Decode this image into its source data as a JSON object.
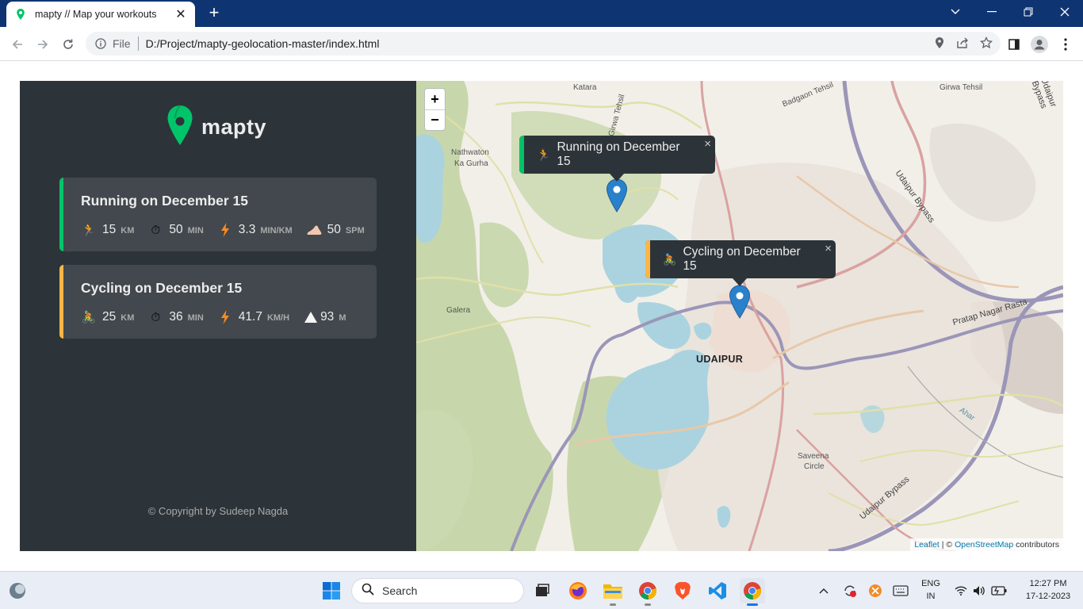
{
  "browser": {
    "tab_title": "mapty // Map your workouts",
    "omnibox_scheme": "File",
    "url": "D:/Project/mapty-geolocation-master/index.html"
  },
  "app": {
    "logo_text": "mapty",
    "brand_green": "#00c46a",
    "cycling_yellow": "#ffb545",
    "workouts": [
      {
        "type": "running",
        "title": "Running on December 15",
        "stats": [
          {
            "icon": "runner-icon",
            "value": "15",
            "unit": "KM"
          },
          {
            "icon": "stopwatch-icon",
            "value": "50",
            "unit": "MIN"
          },
          {
            "icon": "lightning-icon",
            "value": "3.3",
            "unit": "MIN/KM"
          },
          {
            "icon": "foot-icon",
            "value": "50",
            "unit": "SPM"
          }
        ]
      },
      {
        "type": "cycling",
        "title": "Cycling on December 15",
        "stats": [
          {
            "icon": "cyclist-icon",
            "value": "25",
            "unit": "KM"
          },
          {
            "icon": "stopwatch-icon",
            "value": "36",
            "unit": "MIN"
          },
          {
            "icon": "lightning-icon",
            "value": "41.7",
            "unit": "KM/H"
          },
          {
            "icon": "mountain-icon",
            "value": "93",
            "unit": "M"
          }
        ]
      }
    ],
    "copyright": "© Copyright by Sudeep Nagda"
  },
  "map": {
    "zoom_in": "+",
    "zoom_out": "−",
    "popups": [
      {
        "text": "Running on December 15",
        "close": "×"
      },
      {
        "text": "Cycling on December 15",
        "close": "×"
      }
    ],
    "labels": {
      "katara": "Katara",
      "badgaon": "Badgaon Tehsil",
      "girwa": "Girwa Tehsil",
      "girwa_vertical": "Girwa Tehsil",
      "nathwaton": "Nathwaton",
      "ka_gurha": "Ka Gurha",
      "galera": "Galera",
      "udaipur": "UDAIPUR",
      "udaipur_bypass": "Udaipur Bypass",
      "udaipur_bypass2": "Udaipur Bypass",
      "pratap_nagar": "Pratap Nagar Rasta",
      "saveena": "Saveena",
      "circle": "Circle",
      "ahar": "Ahar"
    },
    "attribution": {
      "leaflet": "Leaflet",
      "sep": " | © ",
      "osm": "OpenStreetMap",
      "contributors": " contributors"
    }
  },
  "taskbar": {
    "search": "Search",
    "lang": "ENG",
    "region": "IN",
    "time": "12:27 PM",
    "date": "17-12-2023"
  }
}
